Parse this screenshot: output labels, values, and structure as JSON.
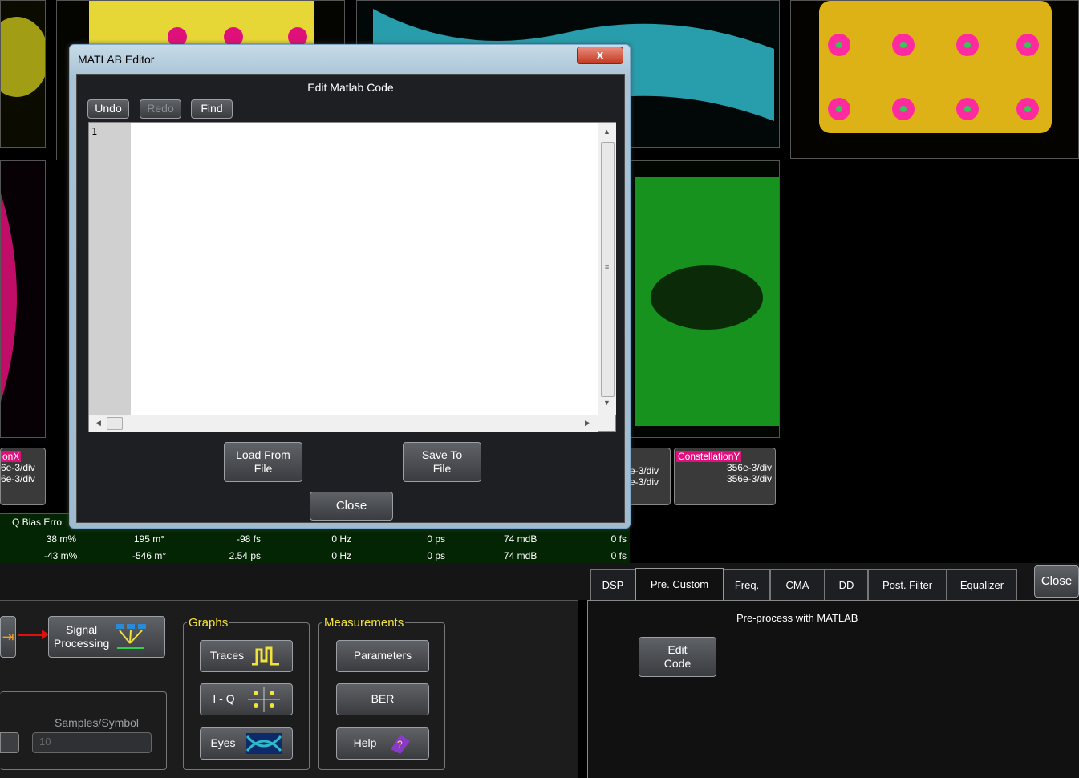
{
  "editor": {
    "window_title": "MATLAB Editor",
    "heading": "Edit Matlab Code",
    "undo_label": "Undo",
    "redo_label": "Redo",
    "find_label": "Find",
    "line_number": "1",
    "code": "",
    "load_label": "Load From\nFile",
    "save_label": "Save To\nFile",
    "close_label": "Close",
    "close_glyph": "x"
  },
  "traces": {
    "left_name": "onX",
    "left_v1": "6e-3/div",
    "left_v2": "6e-3/div",
    "mid_v1": "e-3/div",
    "mid_v2": "e-3/div",
    "right_name": "ConstellationY",
    "right_v1": "356e-3/div",
    "right_v2": "356e-3/div"
  },
  "measurements": {
    "first_header": "Q Bias Erro",
    "row1": [
      "38 m%",
      "195 m°",
      "-98 fs",
      "0 Hz",
      "0 ps",
      "74 mdB",
      "0 fs"
    ],
    "row2": [
      "-43 m%",
      "-546 m°",
      "2.54 ps",
      "0 Hz",
      "0 ps",
      "74 mdB",
      "0 fs"
    ]
  },
  "tabs": [
    "DSP",
    "Pre. Custom",
    "Freq.",
    "CMA",
    "DD",
    "Post. Filter",
    "Equalizer"
  ],
  "panel": {
    "close_label": "Close",
    "subtitle": "Pre-process with MATLAB",
    "edit_code_label": "Edit\nCode"
  },
  "signal_processing": {
    "label": "Signal\nProcessing"
  },
  "graphs": {
    "legend": "Graphs",
    "traces_label": "Traces",
    "iq_label": "I - Q",
    "eyes_label": "Eyes"
  },
  "measurement_group": {
    "legend": "Measurements",
    "parameters_label": "Parameters",
    "ber_label": "BER",
    "help_label": "Help"
  },
  "samples": {
    "label": "Samples/Symbol",
    "value": "10"
  },
  "colors": {
    "yellow": "#f2e33a",
    "cyan": "#2fb9c9",
    "magenta": "#e0107a",
    "green": "#1fc22a",
    "gold": "#f5c519",
    "pink": "#ff2aa0"
  }
}
